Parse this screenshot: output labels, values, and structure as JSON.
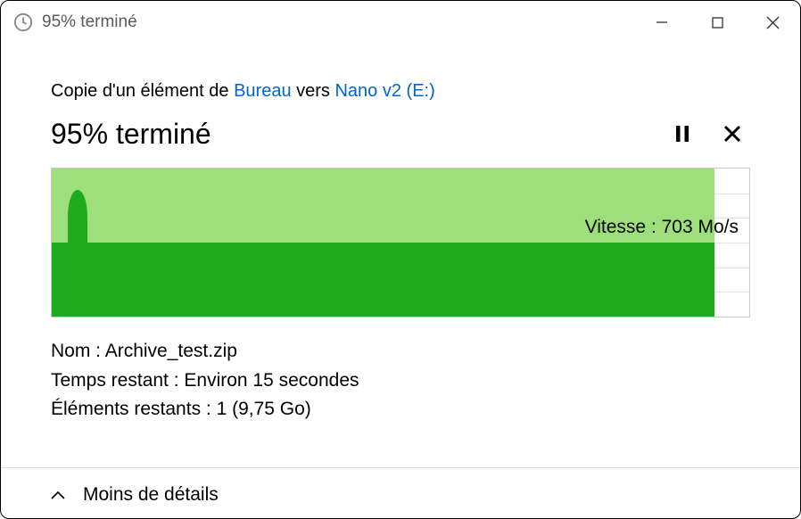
{
  "titlebar": {
    "title": "95% terminé"
  },
  "copy_line": {
    "prefix": "Copie d'un élément de ",
    "source": "Bureau",
    "middle": " vers ",
    "dest": "Nano v2 (E:)"
  },
  "progress": {
    "title": "95% terminé"
  },
  "chart_data": {
    "type": "area",
    "progress_percent": 95,
    "speed_label": "Vitesse : 703 Mo/s",
    "ylim": [
      0,
      1400
    ],
    "current_speed": 703,
    "spike": {
      "x_percent": 3.5,
      "peak_value": 1200
    }
  },
  "details": {
    "name_label": "Nom : ",
    "name_value": "Archive_test.zip",
    "time_label": "Temps restant : ",
    "time_value": "Environ 15 secondes",
    "items_label": "Éléments restants : ",
    "items_value": "1 (9,75 Go)"
  },
  "footer": {
    "toggle": "Moins de détails"
  }
}
